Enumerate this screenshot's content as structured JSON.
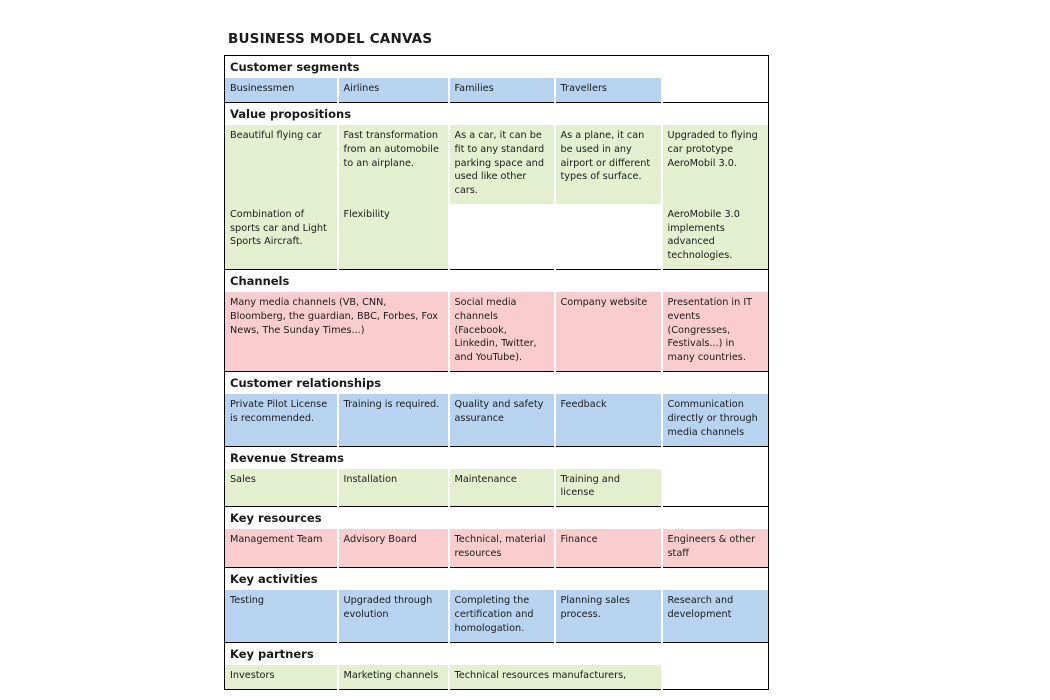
{
  "document": {
    "title": "BUSINESS MODEL CANVAS"
  },
  "colors": {
    "blue": "#b8d3f0",
    "green": "#e3efcf",
    "pink": "#f9cdcd",
    "border": "#000000",
    "text": "#1a1a1a",
    "background": "#ffffff"
  },
  "sections": [
    {
      "id": "customer-segments",
      "heading": "Customer segments",
      "color": "blue",
      "rows": [
        {
          "cells": [
            {
              "text": "Businessmen",
              "fill": "blue",
              "span": 1
            },
            {
              "text": "Airlines",
              "fill": "blue",
              "span": 1
            },
            {
              "text": "Families",
              "fill": "blue",
              "span": 1
            },
            {
              "text": "Travellers",
              "fill": "blue",
              "span": 1
            },
            {
              "text": "",
              "fill": "empty",
              "span": 1
            }
          ]
        }
      ]
    },
    {
      "id": "value-propositions",
      "heading": "Value propositions",
      "color": "green",
      "rows": [
        {
          "cells": [
            {
              "text": "Beautiful flying car",
              "fill": "green",
              "span": 1
            },
            {
              "text": "Fast transformation from an automobile to an airplane.",
              "fill": "green",
              "span": 1
            },
            {
              "text": "As a car, it can be fit to any standard parking space and used like other cars.",
              "fill": "green",
              "span": 1
            },
            {
              "text": "As a plane, it can be used in any airport or different types of surface.",
              "fill": "green",
              "span": 1
            },
            {
              "text": "Upgraded to flying car prototype AeroMobil 3.0.",
              "fill": "green",
              "span": 1
            }
          ]
        },
        {
          "cells": [
            {
              "text": "Combination of sports car and Light Sports Aircraft.",
              "fill": "green",
              "span": 1
            },
            {
              "text": "Flexibility",
              "fill": "green",
              "span": 1
            },
            {
              "text": "",
              "fill": "empty",
              "span": 1
            },
            {
              "text": "",
              "fill": "empty",
              "span": 1
            },
            {
              "text": "AeroMobile 3.0 implements advanced technologies.",
              "fill": "green",
              "span": 1
            }
          ]
        }
      ]
    },
    {
      "id": "channels",
      "heading": "Channels",
      "color": "pink",
      "rows": [
        {
          "cells": [
            {
              "text": "Many media channels (VB, CNN, Bloomberg, the guardian, BBC, Forbes, Fox News, The Sunday Times...)",
              "fill": "pink",
              "span": 2
            },
            {
              "text": "Social media channels (Facebook, Linkedin, Twitter, and YouTube).",
              "fill": "pink",
              "span": 1
            },
            {
              "text": "Company website",
              "fill": "pink",
              "span": 1
            },
            {
              "text": "Presentation in IT events (Congresses, Festivals...) in many countries.",
              "fill": "pink",
              "span": 1
            }
          ]
        }
      ]
    },
    {
      "id": "customer-relationships",
      "heading": "Customer relationships",
      "color": "blue",
      "rows": [
        {
          "cells": [
            {
              "text": "Private Pilot License is recommended.",
              "fill": "blue",
              "span": 1
            },
            {
              "text": "Training is required.",
              "fill": "blue",
              "span": 1
            },
            {
              "text": "Quality and safety assurance",
              "fill": "blue",
              "span": 1
            },
            {
              "text": "Feedback",
              "fill": "blue",
              "span": 1
            },
            {
              "text": "Communication directly or through media channels",
              "fill": "blue",
              "span": 1
            }
          ]
        }
      ]
    },
    {
      "id": "revenue-streams",
      "heading": "Revenue Streams",
      "color": "green",
      "rows": [
        {
          "cells": [
            {
              "text": "Sales",
              "fill": "green",
              "span": 1
            },
            {
              "text": "Installation",
              "fill": "green",
              "span": 1
            },
            {
              "text": "Maintenance",
              "fill": "green",
              "span": 1
            },
            {
              "text": "Training and license",
              "fill": "green",
              "span": 1
            },
            {
              "text": "",
              "fill": "empty",
              "span": 1
            }
          ]
        }
      ]
    },
    {
      "id": "key-resources",
      "heading": "Key resources",
      "color": "pink",
      "rows": [
        {
          "cells": [
            {
              "text": "Management Team",
              "fill": "pink",
              "span": 1
            },
            {
              "text": "Advisory Board",
              "fill": "pink",
              "span": 1
            },
            {
              "text": "Technical, material resources",
              "fill": "pink",
              "span": 1
            },
            {
              "text": "Finance",
              "fill": "pink",
              "span": 1
            },
            {
              "text": "Engineers & other staff",
              "fill": "pink",
              "span": 1
            }
          ]
        }
      ]
    },
    {
      "id": "key-activities",
      "heading": "Key activities",
      "color": "blue",
      "rows": [
        {
          "cells": [
            {
              "text": "Testing",
              "fill": "blue",
              "span": 1
            },
            {
              "text": "Upgraded through evolution",
              "fill": "blue",
              "span": 1
            },
            {
              "text": "Completing the certification and homologation.",
              "fill": "blue",
              "span": 1
            },
            {
              "text": "Planning sales process.",
              "fill": "blue",
              "span": 1
            },
            {
              "text": "Research and development",
              "fill": "blue",
              "span": 1
            }
          ]
        }
      ]
    },
    {
      "id": "key-partners",
      "heading": "Key partners",
      "color": "green",
      "rows": [
        {
          "cells": [
            {
              "text": "Investors",
              "fill": "green",
              "span": 1
            },
            {
              "text": "Marketing channels",
              "fill": "green",
              "span": 1
            },
            {
              "text": "Technical resources manufacturers,",
              "fill": "green",
              "span": 2
            },
            {
              "text": "",
              "fill": "empty",
              "span": 1
            }
          ]
        }
      ]
    }
  ]
}
